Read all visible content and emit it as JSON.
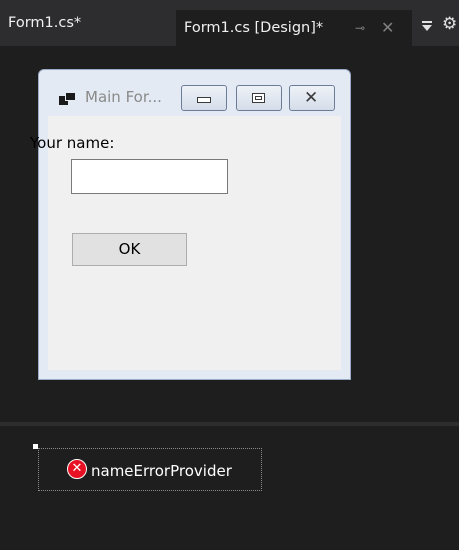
{
  "tabs": [
    {
      "label": "Form1.cs*",
      "active": false
    },
    {
      "label": "Form1.cs [Design]*",
      "active": true,
      "pin_glyph": "⊸",
      "close_glyph": "✕"
    }
  ],
  "tab_menu": {
    "icon": "dropdown-icon",
    "gear_icon": "gear-icon",
    "gear_glyph": "⚙"
  },
  "form": {
    "title": "Main For...",
    "app_icon": "window-icon",
    "caption_buttons": [
      "minimize",
      "maximize",
      "close"
    ],
    "close_glyph": "✕",
    "name_label": "Your name:",
    "name_value": "",
    "ok_button": "OK"
  },
  "tray": {
    "components": [
      {
        "name": "nameErrorProvider",
        "icon": "error-icon",
        "icon_glyph": "✕"
      }
    ]
  },
  "colors": {
    "ide_background": "#1e1e1e",
    "tab_strip": "#2d2d30",
    "error_red": "#e81123"
  }
}
